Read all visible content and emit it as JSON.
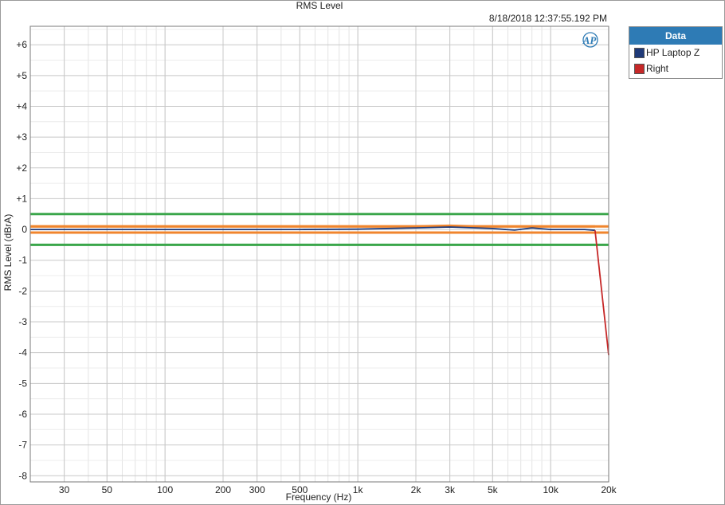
{
  "window": {
    "title": "RMS Level",
    "timestamp": "8/18/2018 12:37:55.192 PM"
  },
  "logo": {
    "text": "AP",
    "icon": "ap-logo-icon"
  },
  "legend": {
    "header": "Data",
    "items": [
      {
        "label": "HP Laptop Z",
        "color": "#1f3a78"
      },
      {
        "label": "Right",
        "color": "#c62828"
      }
    ]
  },
  "chart_data": {
    "type": "line",
    "title": "RMS Level",
    "xlabel": "Frequency (Hz)",
    "ylabel": "RMS Level (dBrA)",
    "x_scale": "log",
    "xlim": [
      20,
      20000
    ],
    "ylim": [
      -8.2,
      6.6
    ],
    "grid": true,
    "legend_position": "top-right, outside plot",
    "x_ticks": [
      {
        "value": 30,
        "label": "30"
      },
      {
        "value": 50,
        "label": "50"
      },
      {
        "value": 100,
        "label": "100"
      },
      {
        "value": 200,
        "label": "200"
      },
      {
        "value": 300,
        "label": "300"
      },
      {
        "value": 500,
        "label": "500"
      },
      {
        "value": 1000,
        "label": "1k"
      },
      {
        "value": 2000,
        "label": "2k"
      },
      {
        "value": 3000,
        "label": "3k"
      },
      {
        "value": 5000,
        "label": "5k"
      },
      {
        "value": 10000,
        "label": "10k"
      },
      {
        "value": 20000,
        "label": "20k"
      }
    ],
    "y_ticks": [
      {
        "value": 6,
        "label": "+6"
      },
      {
        "value": 5,
        "label": "+5"
      },
      {
        "value": 4,
        "label": "+4"
      },
      {
        "value": 3,
        "label": "+3"
      },
      {
        "value": 2,
        "label": "+2"
      },
      {
        "value": 1,
        "label": "+1"
      },
      {
        "value": 0,
        "label": "0"
      },
      {
        "value": -1,
        "label": "-1"
      },
      {
        "value": -2,
        "label": "-2"
      },
      {
        "value": -3,
        "label": "-3"
      },
      {
        "value": -4,
        "label": "-4"
      },
      {
        "value": -5,
        "label": "-5"
      },
      {
        "value": -6,
        "label": "-6"
      },
      {
        "value": -7,
        "label": "-7"
      },
      {
        "value": -8,
        "label": "-8"
      }
    ],
    "limit_lines": [
      {
        "value": 0.5,
        "color": "#3aa64a"
      },
      {
        "value": -0.5,
        "color": "#3aa64a"
      },
      {
        "value": 0.1,
        "color": "#f0852d"
      },
      {
        "value": -0.1,
        "color": "#f0852d"
      }
    ],
    "series": [
      {
        "name": "HP Laptop Z",
        "color": "#1f3a78",
        "x": [
          20,
          100,
          500,
          1000,
          2000,
          3000,
          5000,
          6500,
          8000,
          10000,
          15000,
          17000
        ],
        "y": [
          0.0,
          0.0,
          0.0,
          0.01,
          0.05,
          0.08,
          0.03,
          -0.02,
          0.05,
          0.0,
          0.0,
          -0.03
        ]
      },
      {
        "name": "Right",
        "color": "#c62828",
        "x": [
          17000,
          20000
        ],
        "y": [
          -0.03,
          -4.08
        ]
      }
    ],
    "highlight_series": {
      "color": "#f0852d",
      "x": [
        20,
        1000,
        2000,
        3000,
        4000,
        5000,
        10000,
        17000
      ],
      "y": [
        0.1,
        0.1,
        0.1,
        0.12,
        0.1,
        0.1,
        0.1,
        0.1
      ]
    }
  }
}
